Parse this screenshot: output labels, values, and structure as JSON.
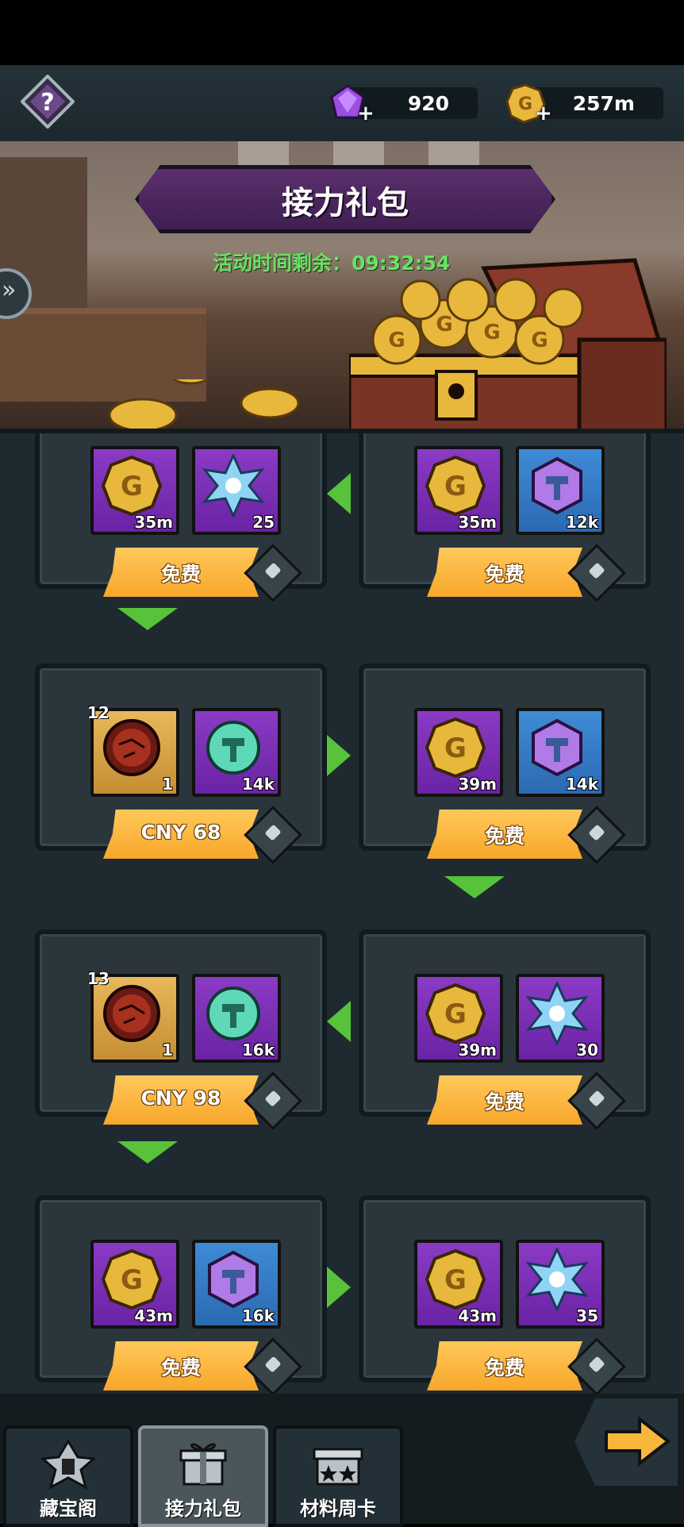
{
  "header": {
    "help_icon": "question-diamond-icon",
    "gems": {
      "icon": "purple-gem-icon",
      "value": "920"
    },
    "gold": {
      "icon": "gold-coin-icon",
      "value": "257m"
    }
  },
  "banner": {
    "title": "接力礼包",
    "timer_label": "活动时间剩余：",
    "timer_value": "09:32:54"
  },
  "rows": [
    {
      "left": {
        "items": [
          {
            "type": "gold-coin",
            "qty": "35m",
            "bg": "purple"
          },
          {
            "type": "blue-crystal",
            "qty": "25",
            "bg": "purple"
          }
        ],
        "button": "免费"
      },
      "right": {
        "items": [
          {
            "type": "gold-coin",
            "qty": "35m",
            "bg": "purple"
          },
          {
            "type": "hammer-stone",
            "qty": "12k",
            "bg": "blue"
          }
        ],
        "button": "免费"
      }
    },
    {
      "left": {
        "items": [
          {
            "type": "red-orb",
            "qty": "1",
            "level": "12",
            "bg": "gold"
          },
          {
            "type": "green-hammer-stone",
            "qty": "14k",
            "bg": "purple"
          }
        ],
        "button": "CNY 68"
      },
      "right": {
        "items": [
          {
            "type": "gold-coin",
            "qty": "39m",
            "bg": "purple"
          },
          {
            "type": "hammer-stone",
            "qty": "14k",
            "bg": "blue"
          }
        ],
        "button": "免费"
      }
    },
    {
      "left": {
        "items": [
          {
            "type": "red-orb",
            "qty": "1",
            "level": "13",
            "bg": "gold"
          },
          {
            "type": "green-hammer-stone",
            "qty": "16k",
            "bg": "purple"
          }
        ],
        "button": "CNY 98"
      },
      "right": {
        "items": [
          {
            "type": "gold-coin",
            "qty": "39m",
            "bg": "purple"
          },
          {
            "type": "blue-crystal",
            "qty": "30",
            "bg": "purple"
          }
        ],
        "button": "免费"
      }
    },
    {
      "left": {
        "items": [
          {
            "type": "gold-coin",
            "qty": "43m",
            "bg": "purple"
          },
          {
            "type": "hammer-stone",
            "qty": "16k",
            "bg": "blue"
          }
        ],
        "button": "免费"
      },
      "right": {
        "items": [
          {
            "type": "gold-coin",
            "qty": "43m",
            "bg": "purple"
          },
          {
            "type": "blue-crystal",
            "qty": "35",
            "bg": "purple"
          }
        ],
        "button": "免费"
      }
    }
  ],
  "tabs": [
    {
      "label": "藏宝阁",
      "icon": "treasure-pavilion-icon",
      "active": false
    },
    {
      "label": "接力礼包",
      "icon": "relay-gift-icon",
      "active": true
    },
    {
      "label": "材料周卡",
      "icon": "material-card-icon",
      "active": false
    }
  ],
  "colors": {
    "accent_green": "#57c23a",
    "button_orange": "#f7a72a",
    "timer_green": "#6be064"
  }
}
